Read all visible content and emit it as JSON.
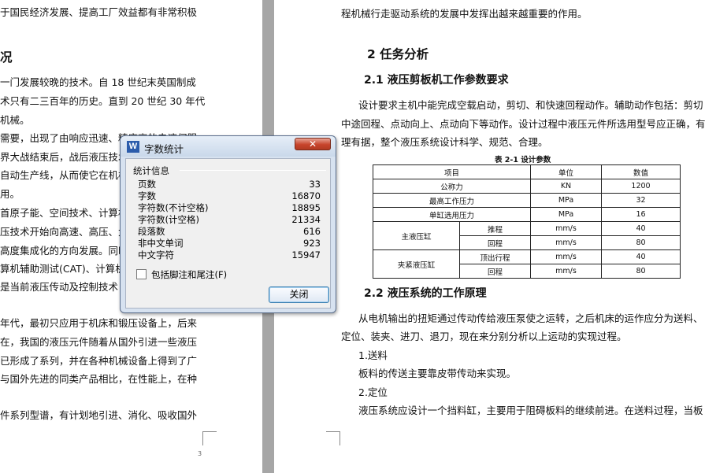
{
  "left_page": {
    "lines": [
      "于国民经济发展、提高工厂效益都有非常积极",
      "况",
      "一门发展较晚的技术。自 18 世纪末英国制成",
      "术只有二三百年的历史。直到 20 世纪 30 年代",
      "机械。",
      "需要，出现了由响应迅速、精度高的电液伺服",
      "界大战结束后，战后液压技术",
      "自动生产线，从而使它在机械",
      "用。",
      "首原子能、空间技术、计算机",
      "压技术开始向高速、高压、大",
      "高度集成化的方向发展。同时",
      "算机辅助测试(CAT)、计算机",
      "是当前液压传动及控制技术",
      "年代，最初只应用于机床和锻压设备上，后来",
      "在，我国的液压元件随着从国外引进一些液压",
      "已形成了系列，并在各种机械设备上得到了广",
      "与国外先进的同类产品相比，在性能上，在种",
      "件系列型谱，有计划地引进、消化、吸收国外"
    ],
    "page_number": "3"
  },
  "right_page": {
    "intro_line": "程机械行走驱动系统的发展中发挥出越来越重要的作用。",
    "section_heading": "2   任务分析",
    "sub1_heading": "2.1   液压剪板机工作参数要求",
    "sub1_lines": [
      "设计要求主机中能完成空载启动，剪切、和快速回程动作。辅助动作包括：剪切",
      "中途回程、点动向上、点动向下等动作。设计过程中液压元件所选用型号应正确，有",
      "理有据，整个液压系统设计科学、规范、合理。"
    ],
    "table": {
      "caption": "表 2-1 设计参数",
      "headers": [
        "项目",
        "单位",
        "数值"
      ],
      "rows": [
        {
          "item": "公称力",
          "unit": "KN",
          "value": "1200"
        },
        {
          "item": "最高工作压力",
          "unit": "MPa",
          "value": "32"
        },
        {
          "item": "单缸选用压力",
          "unit": "MPa",
          "value": "16"
        }
      ],
      "groups": [
        {
          "name": "主液压缸",
          "rows": [
            {
              "sub": "推程",
              "unit": "mm/s",
              "value": "40"
            },
            {
              "sub": "回程",
              "unit": "mm/s",
              "value": "80"
            }
          ]
        },
        {
          "name": "夹紧液压缸",
          "rows": [
            {
              "sub": "顶出行程",
              "unit": "mm/s",
              "value": "40"
            },
            {
              "sub": "回程",
              "unit": "mm/s",
              "value": "80"
            }
          ]
        }
      ]
    },
    "sub2_heading": "2.2   液压系统的工作原理",
    "sub2_lines": [
      "从电机输出的扭矩通过传动传给液压泵使之运转，之后机床的运作应分为送料、",
      "定位、装夹、进刀、退刀，现在来分别分析以上运动的实现过程。",
      "1.送料",
      "板料的传送主要靠皮带传动来实现。",
      "2.定位",
      "液压系统应设计一个挡料缸，主要用于阻碍板料的继续前进。在送料过程，当板"
    ]
  },
  "dialog": {
    "icon_letter": "W",
    "title": "字数统计",
    "close_glyph": "✕",
    "group_label": "统计信息",
    "stats": [
      {
        "label": "页数",
        "value": "33"
      },
      {
        "label": "字数",
        "value": "16870"
      },
      {
        "label": "字符数(不计空格)",
        "value": "18895"
      },
      {
        "label": "字符数(计空格)",
        "value": "21334"
      },
      {
        "label": "段落数",
        "value": "616"
      },
      {
        "label": "非中文单词",
        "value": "923"
      },
      {
        "label": "中文字符",
        "value": "15947"
      }
    ],
    "checkbox_label": "包括脚注和尾注(F)",
    "checkbox_checked": false,
    "close_button": "关闭"
  }
}
